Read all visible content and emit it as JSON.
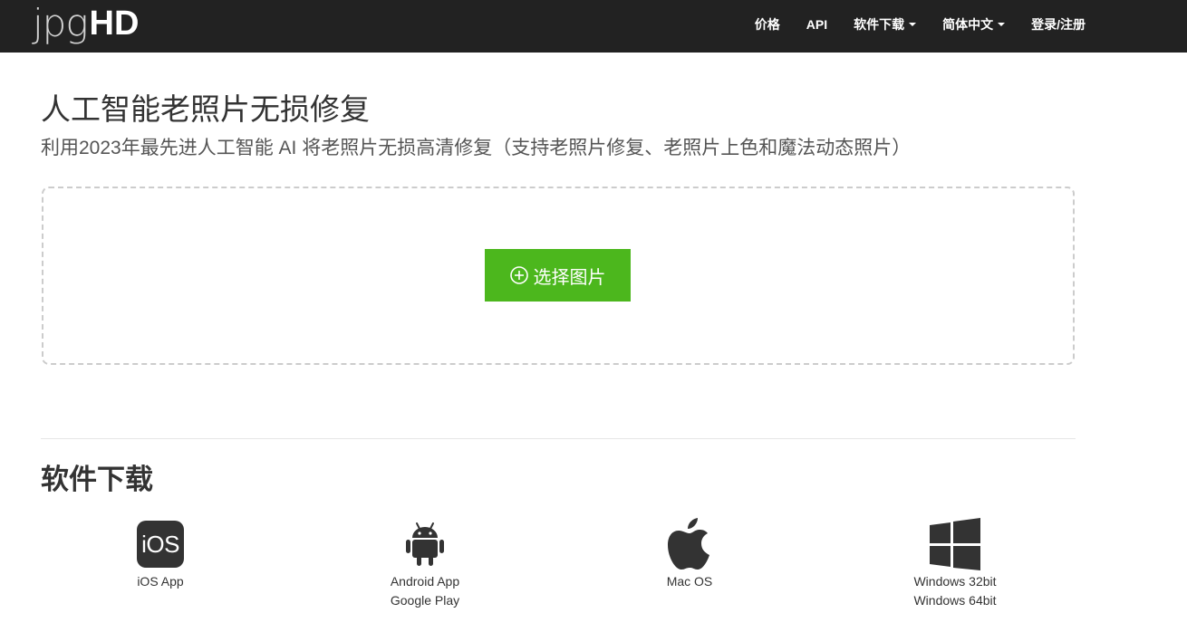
{
  "brand": {
    "logo_light": "jpg",
    "logo_bold": "HD"
  },
  "nav": {
    "pricing": "价格",
    "api": "API",
    "software_download": "软件下载",
    "language": "简体中文",
    "login": "登录/注册"
  },
  "hero": {
    "title": "人工智能老照片无损修复",
    "subtitle": "利用2023年最先进人工智能 AI 将老照片无损高清修复（支持老照片修复、老照片上色和魔法动态照片）"
  },
  "upload": {
    "button_label": "选择图片"
  },
  "downloads": {
    "title": "软件下载",
    "items": [
      {
        "icon": "ios-icon",
        "icon_text": "iOS",
        "line1": "iOS App",
        "line2": ""
      },
      {
        "icon": "android-icon",
        "line1": "Android App",
        "line2": "Google Play"
      },
      {
        "icon": "apple-icon",
        "line1": "Mac OS",
        "line2": ""
      },
      {
        "icon": "windows-icon",
        "line1": "Windows 32bit",
        "line2": "Windows 64bit"
      }
    ]
  },
  "colors": {
    "navbar_bg": "#222222",
    "accent_green": "#4cb71d",
    "text": "#333333",
    "dropzone_border": "#cccccc"
  }
}
